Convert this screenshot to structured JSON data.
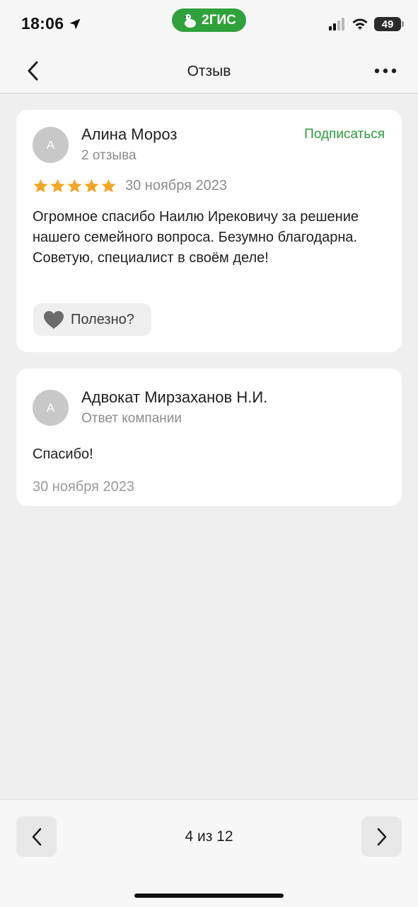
{
  "status_bar": {
    "time": "18:06",
    "battery": "49",
    "app_badge": "2ГИС"
  },
  "header": {
    "title": "Отзыв",
    "back_icon": "chevron-left-icon",
    "more_icon": "ellipsis-icon"
  },
  "review": {
    "avatar_letter": "А",
    "author": "Алина Мороз",
    "reviews_count": "2 отзыва",
    "subscribe_label": "Подписаться",
    "rating": 5,
    "date": "30 ноября 2023",
    "text": "Огромное спасибо Наилю Ирековичу за решение нашего семейного вопроса. Безумно благодарна. Советую, специалист в своём деле!",
    "helpful_label": "Полезно?"
  },
  "reply": {
    "avatar_letter": "А",
    "author": "Адвокат Мирзаханов Н.И.",
    "subtitle": "Ответ компании",
    "text": "Спасибо!",
    "date": "30 ноября 2023"
  },
  "pager": {
    "text": "4 из 12"
  },
  "colors": {
    "accent_green": "#2a9e3a",
    "star": "#f5a623",
    "background": "#efefef"
  }
}
